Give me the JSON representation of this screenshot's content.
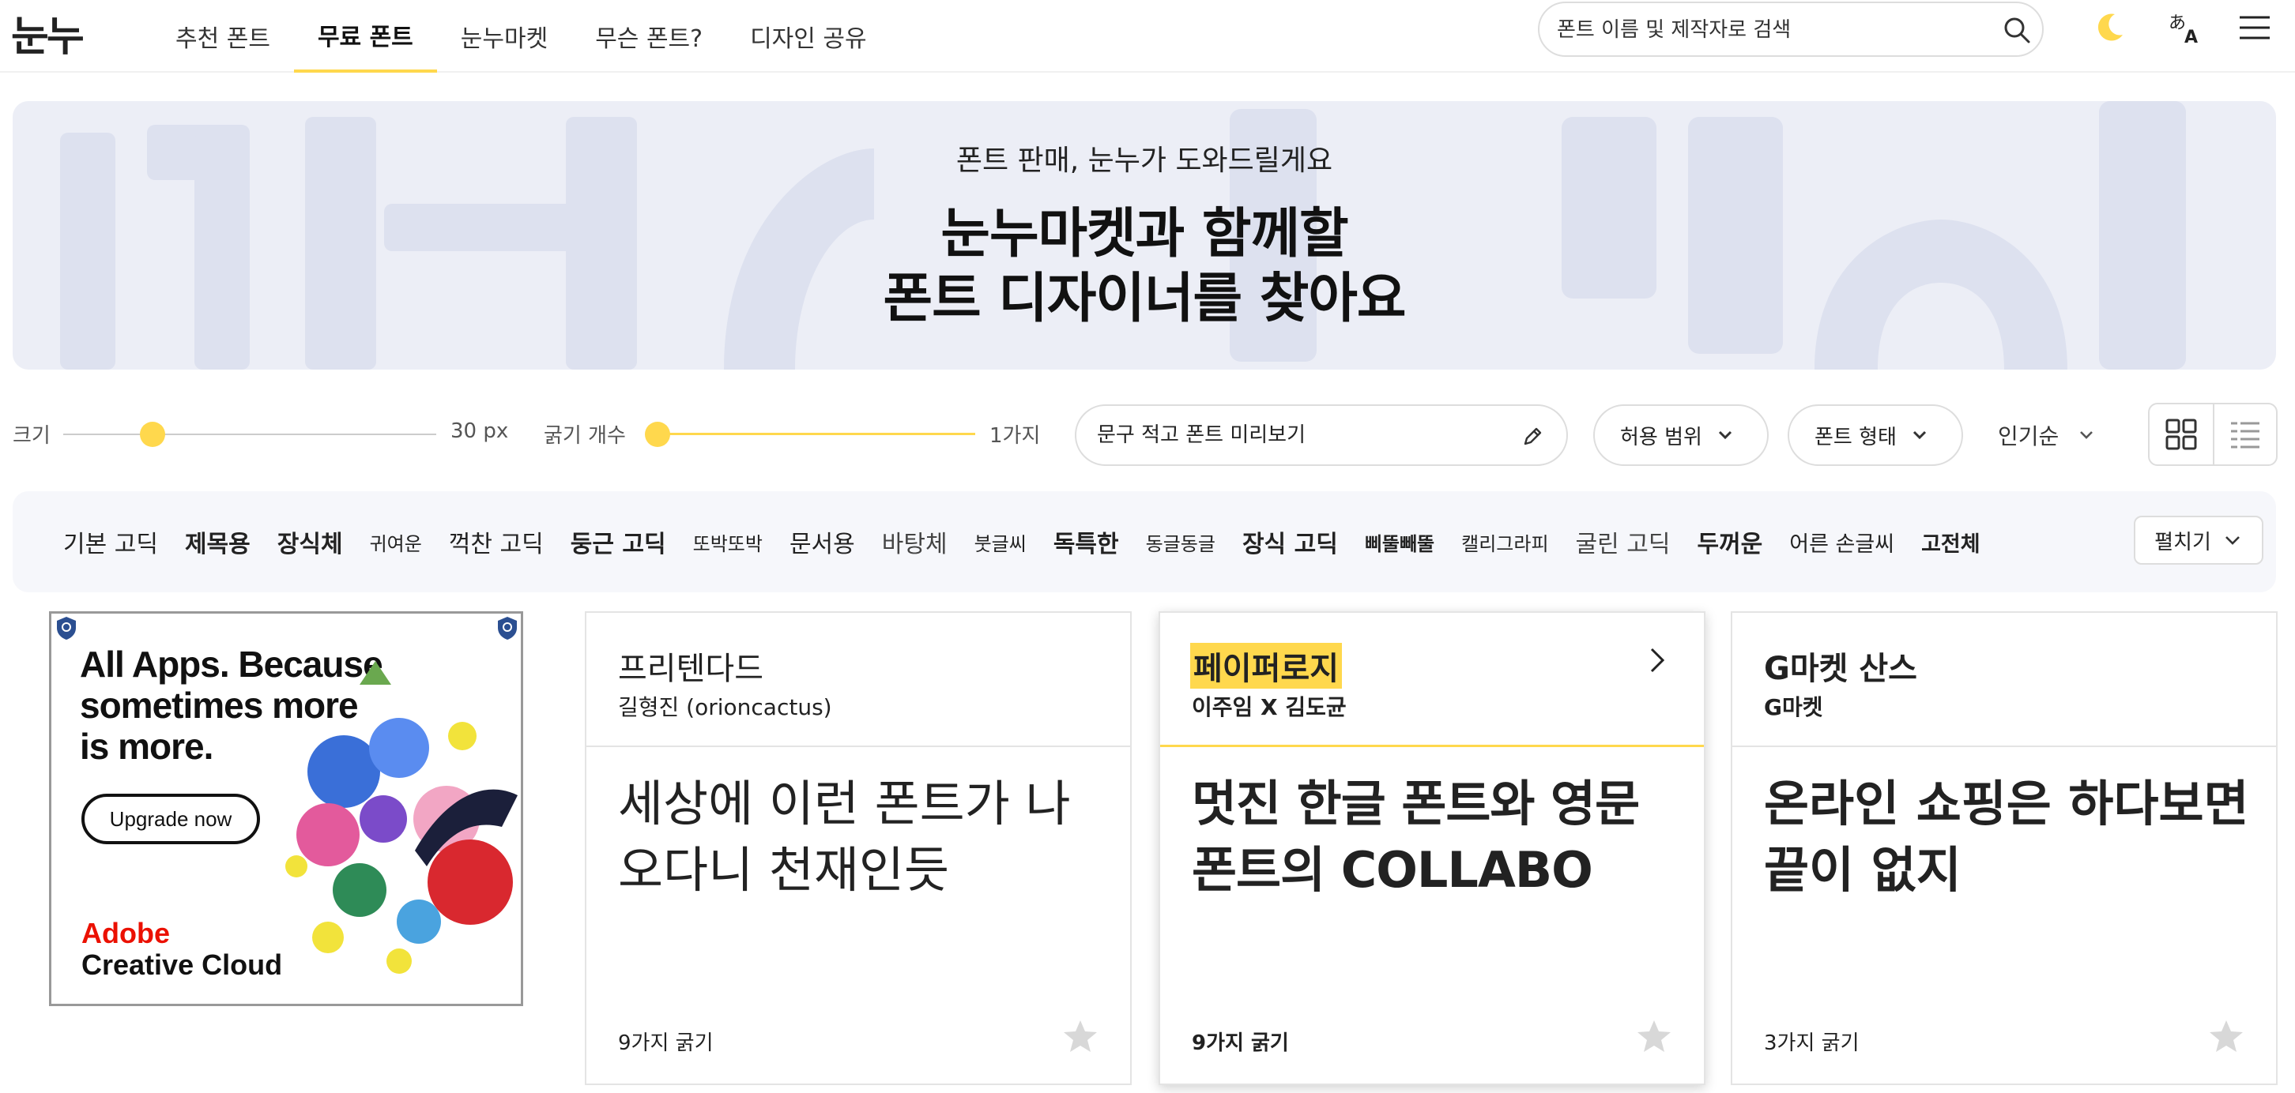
{
  "header": {
    "logo": "눈누",
    "nav": [
      {
        "label": "추천 폰트",
        "active": false
      },
      {
        "label": "무료 폰트",
        "active": true
      },
      {
        "label": "눈누마켓",
        "active": false
      },
      {
        "label": "무슨 폰트?",
        "active": false
      },
      {
        "label": "디자인 공유",
        "active": false
      }
    ],
    "search_placeholder": "폰트 이름 및 제작자로 검색",
    "icons": [
      "search-icon",
      "moon-icon",
      "translate-icon",
      "menu-icon"
    ]
  },
  "banner": {
    "subtitle": "폰트 판매, 눈누가 도와드릴게요",
    "title_line1": "눈누마켓과 함께할",
    "title_line2": "폰트 디자이너를 찾아요"
  },
  "controls": {
    "size_label": "크기",
    "size_value": "30 px",
    "size_level": 0.24,
    "weights_label": "굵기 개수",
    "weights_value": "1가지",
    "weights_level": 0.0,
    "preview_placeholder": "문구 적고 폰트 미리보기",
    "license_label": "허용 범위",
    "type_label": "폰트 형태",
    "sort_label": "인기순",
    "accent_color": "#ffd84d"
  },
  "categories": {
    "items": [
      "기본 고딕",
      "제목용",
      "장식체",
      "귀여운",
      "꺽찬 고딕",
      "둥근 고딕",
      "또박또박",
      "문서용",
      "바탕체",
      "붓글씨",
      "독특한",
      "동글동글",
      "장식 고딕",
      "삐뚤빼뚤",
      "캘리그라피",
      "굴린 고딕",
      "두꺼운",
      "어른 손글씨",
      "고전체"
    ],
    "expand_label": "펼치기"
  },
  "ad": {
    "headline_line1": "All Apps. Because",
    "headline_line2": "sometimes more",
    "headline_line3": "is more.",
    "cta": "Upgrade now",
    "brand_line1": "Adobe",
    "brand_line2": "Creative Cloud"
  },
  "cards": [
    {
      "name": "프리텐다드",
      "author": "길형진 (orioncactus)",
      "sample": "세상에 이런 폰트가 나오다니 천재인듯",
      "weights": "9가지 굵기"
    },
    {
      "name": "페이퍼로지",
      "author": "이주임 X 김도균",
      "sample": "멋진 한글 폰트와 영문 폰트의 COLLABO",
      "weights": "9가지 굵기"
    },
    {
      "name": "G마켓 산스",
      "author": "G마켓",
      "sample": "온라인 쇼핑은 하다보면 끝이 없지",
      "weights": "3가지 굵기"
    }
  ]
}
